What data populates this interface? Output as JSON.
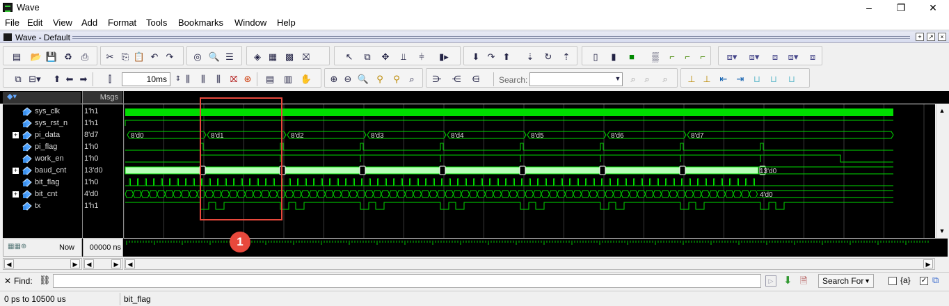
{
  "window": {
    "title": "Wave",
    "minimize": "–",
    "maximize": "❐",
    "close": "✕"
  },
  "menu": [
    "File",
    "Edit",
    "View",
    "Add",
    "Format",
    "Tools",
    "Bookmarks",
    "Window",
    "Help"
  ],
  "panel": {
    "title": "Wave - Default"
  },
  "toolbar": {
    "time_step": "10ms",
    "search_label": "Search:",
    "search_placeholder": ""
  },
  "header": {
    "msgs": "Msgs"
  },
  "signals": [
    {
      "name": "sys_clk",
      "value": "1'h1",
      "expandable": false
    },
    {
      "name": "sys_rst_n",
      "value": "1'h1",
      "expandable": false
    },
    {
      "name": "pi_data",
      "value": "8'd7",
      "expandable": true
    },
    {
      "name": "pi_flag",
      "value": "1'h0",
      "expandable": false
    },
    {
      "name": "work_en",
      "value": "1'h0",
      "expandable": false
    },
    {
      "name": "baud_cnt",
      "value": "13'd0",
      "expandable": true
    },
    {
      "name": "bit_flag",
      "value": "1'h0",
      "expandable": false
    },
    {
      "name": "bit_cnt",
      "value": "4'd0",
      "expandable": true
    },
    {
      "name": "tx",
      "value": "1'h1",
      "expandable": false
    }
  ],
  "wave_labels": {
    "pi_data": [
      "8'd0",
      "8'd1",
      "8'd2",
      "8'd3",
      "8'd4",
      "8'd5",
      "8'd6",
      "8'd7"
    ],
    "baud_cnt_end": "13'd0",
    "bit_cnt_end": "4'd0"
  },
  "annotation": {
    "marker": "1",
    "color": "#e8483c"
  },
  "cursor": {
    "now_label": "Now",
    "now_value": "00000 ns"
  },
  "find": {
    "close": "✕",
    "label": "Find:",
    "search_for": "Search For",
    "option_a": "{a}"
  },
  "status": {
    "range": "0 ps to 10500 us",
    "selected": "bit_flag"
  },
  "colors": {
    "wave": "#00dd00",
    "background": "#000000",
    "grid": "#3a3a3a"
  }
}
